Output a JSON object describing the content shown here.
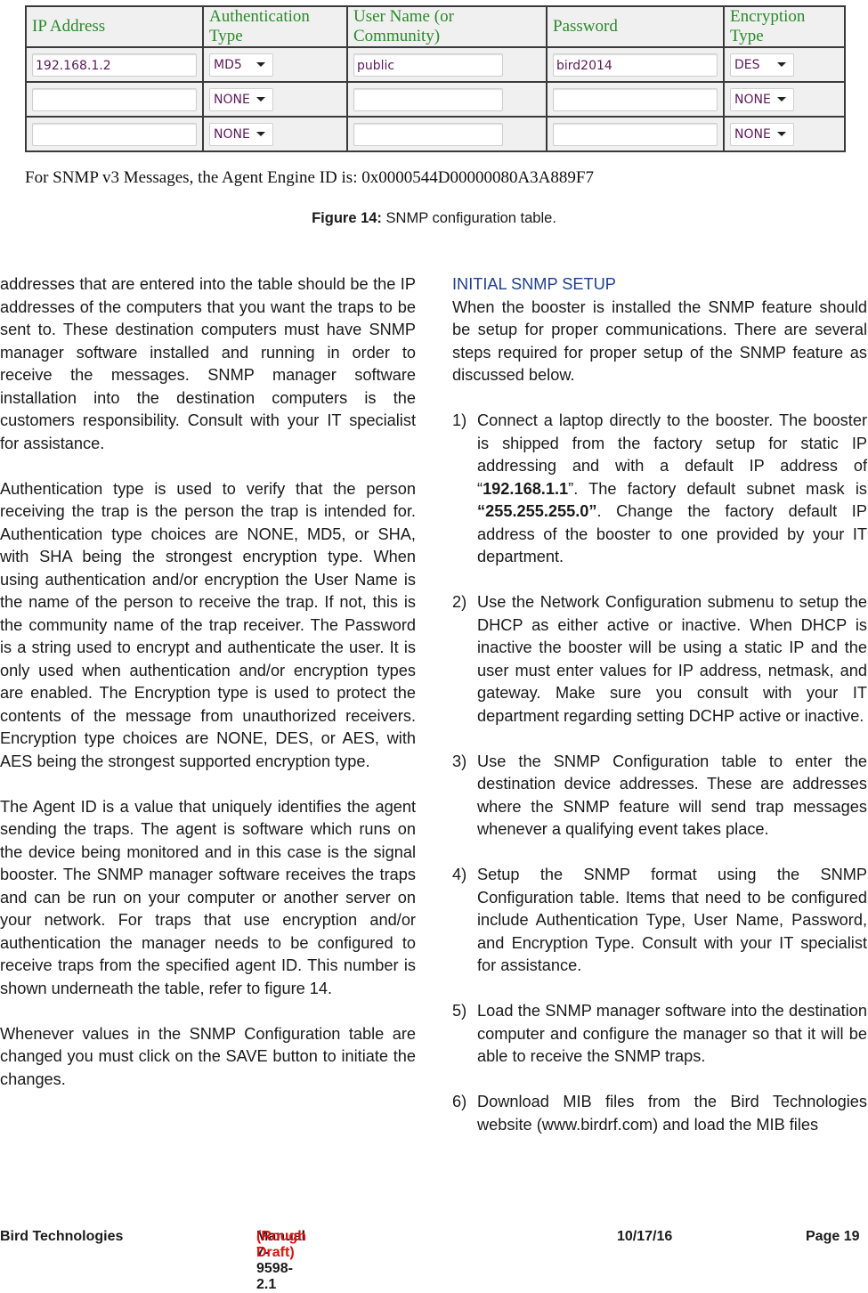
{
  "figure": {
    "table": {
      "headers": [
        "IP Address",
        "Authentication Type",
        "User Name (or Community)",
        "Password",
        "Encryption Type"
      ],
      "rows": [
        {
          "ip": "192.168.1.2",
          "auth": "MD5",
          "user": "public",
          "password": "bird2014",
          "encryption": "DES"
        },
        {
          "ip": "",
          "auth": "NONE",
          "user": "",
          "password": "",
          "encryption": "NONE"
        },
        {
          "ip": "",
          "auth": "NONE",
          "user": "",
          "password": "",
          "encryption": "NONE"
        }
      ]
    },
    "engine_id_text": "For SNMP v3 Messages, the Agent Engine ID is: 0x0000544D00000080A3A889F7",
    "caption_label": "Figure 14:",
    "caption_text": " SNMP configuration table."
  },
  "left_column": {
    "paragraphs": [
      "addresses that are entered into the table should be the IP addresses of the computers that you want the traps to be sent to. These destination computers must have SNMP manager software installed and running in order to receive the messages. SNMP manager software installation into the destination computers is the customers responsibility. Consult with your IT specialist for assistance.",
      "Authentication type is used to verify that the person receiving the trap is the person the trap is intended for. Authentication type choices are NONE, MD5, or SHA, with SHA being the strongest encryption type. When using authentication and/or encryption the User Name is the name of the person to receive the trap. If not, this is the community name of the trap receiver. The Password is a string used to encrypt and authenticate the user. It is only used when authentication and/or encryption types are enabled. The Encryption type is used to protect the contents of the message from unauthorized receivers. Encryption type choices are NONE, DES, or AES, with AES being the strongest supported encryption type.",
      "The Agent ID is a value that uniquely identifies the agent sending the traps. The agent is software which runs on the device being monitored and in this case is the signal booster. The SNMP manager software receives the traps and can be run on your computer or another server on your network. For traps that use encryption and/or authentication the manager needs to be configured to receive traps from the specified agent ID. This number is shown underneath the table, refer to figure 14.",
      "Whenever values in the SNMP Configuration table are changed you must click on the SAVE button to initiate the changes."
    ]
  },
  "right_column": {
    "heading": "INITIAL SNMP SETUP",
    "intro": "When the booster is installed the SNMP feature should be setup for proper communications. There are several steps required for proper setup of the SNMP feature as discussed below.",
    "steps": [
      {
        "num": "1)",
        "pre": "Connect a laptop directly to the booster. The booster is shipped from the factory setup for static IP addressing and with a default IP address of “",
        "bold1": "192.168.1.1",
        "mid": "”. The factory default subnet mask is ",
        "bold2": "“255.255.255.0”",
        "post": ". Change the factory default IP address of the booster to one provided by your IT department."
      },
      {
        "num": "2)",
        "text": "Use the Network Configuration submenu to setup the DHCP as either active or inactive. When DHCP is inactive the booster will be using a static IP and the user must enter values for IP address, netmask, and gateway. Make sure you consult with your IT department regarding setting DCHP active or inactive."
      },
      {
        "num": "3)",
        "text": "Use the SNMP Configuration table to enter the destination device addresses. These are addresses where the SNMP feature will send trap messages whenever a qualifying event takes place."
      },
      {
        "num": "4)",
        "text": "Setup the SNMP format using the SNMP Configuration table. Items that need to be configured include Authentication Type, User Name, Password, and Encryption Type. Consult with your IT specialist for assistance."
      },
      {
        "num": "5)",
        "text": "Load the SNMP manager software into the destination computer and configure the manager so that it will be able to receive the SNMP traps."
      },
      {
        "num": "6)",
        "text": "Download MIB files from the Bird Technologies website (www.birdrf.com) and load the MIB files"
      }
    ]
  },
  "footer": {
    "company": "Bird Technologies",
    "manual": "Manual 7-9598-2.1",
    "draft": "(Rough Draft)",
    "date": "10/17/16",
    "page": "Page 19"
  },
  "colors": {
    "header_text": "#2a8a2a",
    "heading_blue": "#1f3f8f",
    "draft_red": "#e01010"
  }
}
